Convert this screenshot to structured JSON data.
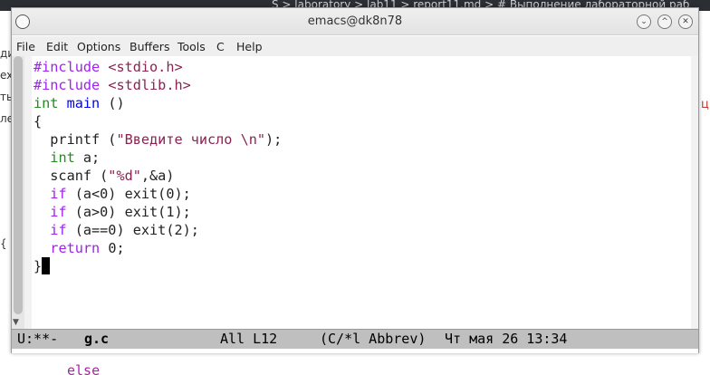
{
  "background": {
    "tabs_text": "S > laboratory > lab11 > report11.md > # Выполнение лабораторной раб",
    "left_fragments": [
      "ди",
      "ex",
      "ть",
      "ле",
      "{"
    ],
    "right_fragment": "ц",
    "bottom_fragment": "else"
  },
  "window": {
    "title": "emacs@dk8n78",
    "buttons": {
      "minimize": "⌄",
      "maximize": "^",
      "close": "✕"
    }
  },
  "menu": [
    "File",
    "Edit",
    "Options",
    "Buffers",
    "Tools",
    "C",
    "Help"
  ],
  "code": {
    "l1": {
      "kw": "#include",
      "rest": " ",
      "str": "<stdio.h>"
    },
    "l2": {
      "kw": "#include",
      "rest": " ",
      "str": "<stdlib.h>"
    },
    "l3": {
      "type": "int",
      "sp": " ",
      "fn": "main",
      "rest": " ()"
    },
    "l4": "{",
    "l5": {
      "a": "  printf (",
      "str": "\"Введите число \\n\"",
      "b": ");"
    },
    "l6": {
      "a": "  ",
      "type": "int",
      "b": " a;"
    },
    "l7": {
      "a": "  scanf (",
      "str": "\"%d\"",
      "b": ",&a)"
    },
    "l8": {
      "a": "  ",
      "kw": "if",
      "b": " (a<0) exit(0);"
    },
    "l9": {
      "a": "  ",
      "kw": "if",
      "b": " (a>0) exit(1);"
    },
    "l10": {
      "a": "  ",
      "kw": "if",
      "b": " (a==0) exit(2);"
    },
    "l11": {
      "a": "  ",
      "kw": "return",
      "b": " 0;"
    },
    "l12": "}"
  },
  "modeline": {
    "status": "U:**-",
    "buffer": "g.c",
    "position": "All L12",
    "modes": "(C/*l Abbrev)",
    "datetime": "Чт мая 26 13:34"
  }
}
